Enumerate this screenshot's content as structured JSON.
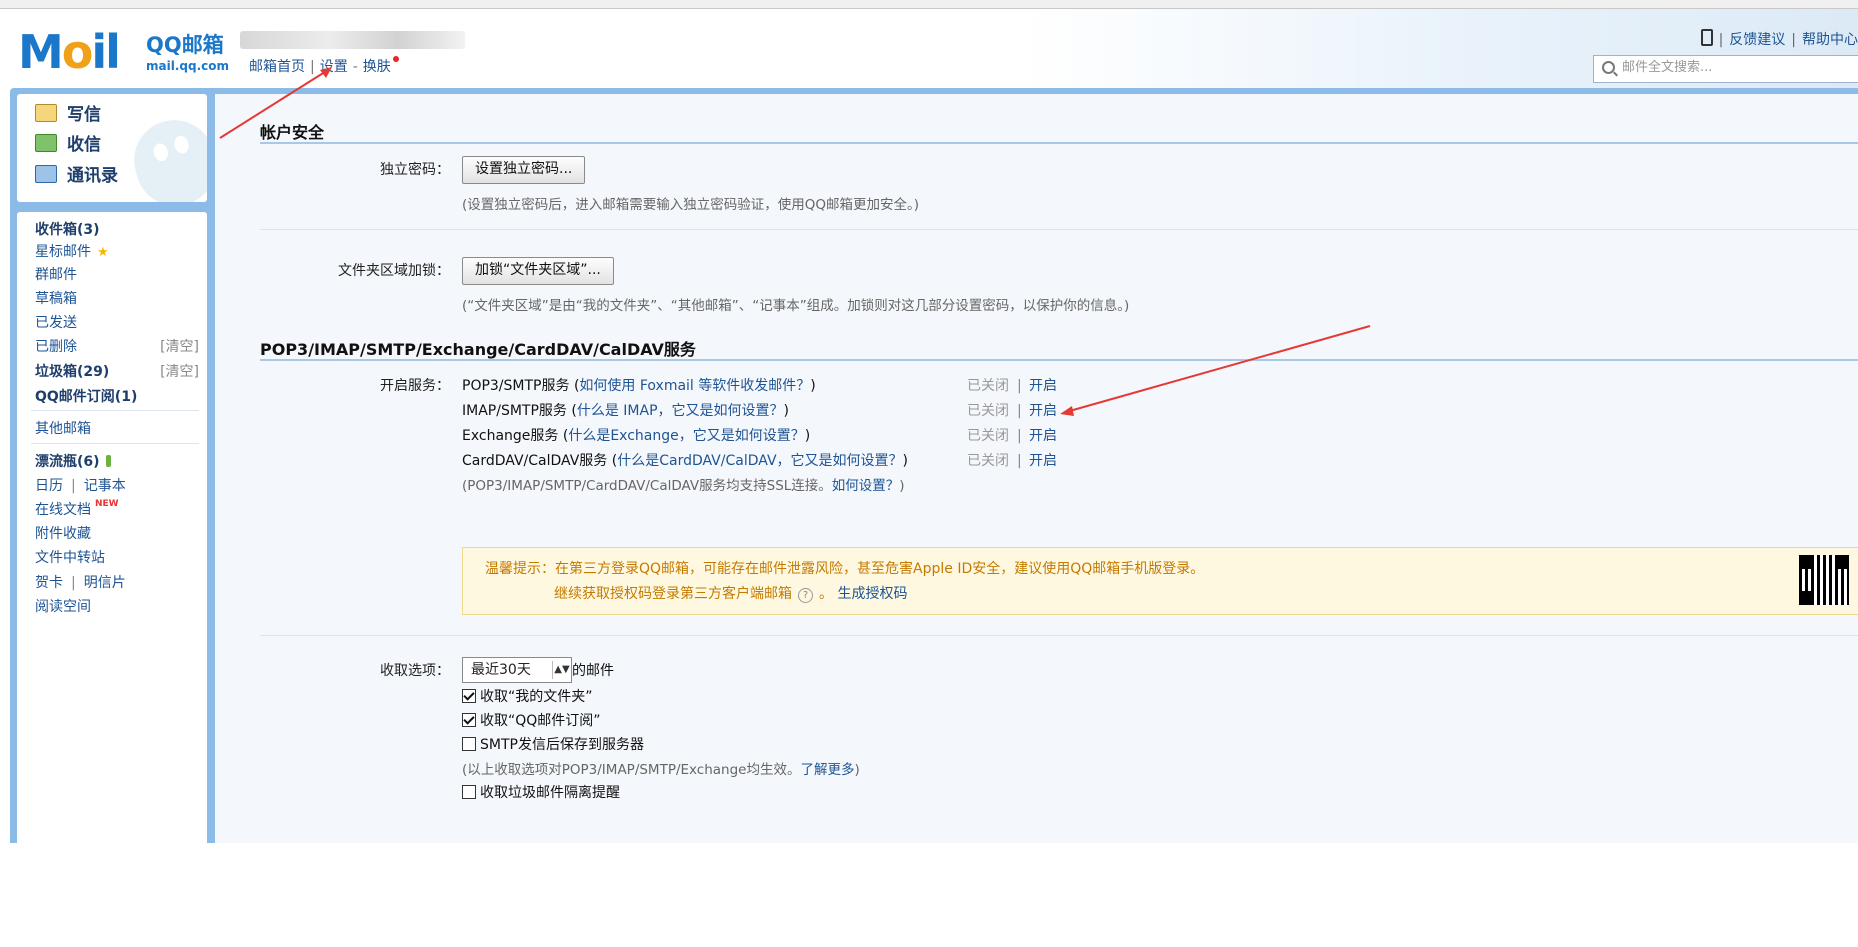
{
  "header": {
    "brand": "QQ邮箱",
    "domain": "mail.qq.com",
    "nav_home": "邮箱首页",
    "nav_settings": "设置",
    "nav_dash": "-",
    "nav_skin": "换肤",
    "feedback": "反馈建议",
    "help": "帮助中心",
    "search_placeholder": "邮件全文搜索..."
  },
  "sidebar": {
    "write": "写信",
    "receive": "收信",
    "contacts": "通讯录",
    "inbox": "收件箱(3)",
    "starred": "星标邮件",
    "group": "群邮件",
    "drafts": "草稿箱",
    "sent": "已发送",
    "deleted": "已删除",
    "clear": "[清空]",
    "spam": "垃圾箱(29)",
    "subscriptions": "QQ邮件订阅(1)",
    "other": "其他邮箱",
    "bottle": "漂流瓶(6)",
    "calendar": "日历",
    "notes": "记事本",
    "docs": "在线文档",
    "new_tag": "NEW",
    "attachments": "附件收藏",
    "transfer": "文件中转站",
    "cards": "贺卡",
    "postcards": "明信片",
    "reading": "阅读空间"
  },
  "security": {
    "title": "帐户安全",
    "pwd_label": "独立密码：",
    "pwd_button": "设置独立密码...",
    "pwd_hint": "(设置独立密码后，进入邮箱需要输入独立密码验证，使用QQ邮箱更加安全。)",
    "folder_label": "文件夹区域加锁：",
    "folder_button": "加锁“文件夹区域”...",
    "folder_hint": "(“文件夹区域”是由“我的文件夹”、“其他邮箱”、“记事本”组成。加锁则对这几部分设置密码，以保护你的信息。)"
  },
  "services": {
    "title": "POP3/IMAP/SMTP/Exchange/CardDAV/CalDAV服务",
    "open_label": "开启服务：",
    "status_closed": "已关闭",
    "open_link": "开启",
    "items": [
      {
        "name": "POP3/SMTP服务 (",
        "help": "如何使用 Foxmail 等软件收发邮件？",
        "close": ")"
      },
      {
        "name": "IMAP/SMTP服务 (",
        "help": "什么是 IMAP，它又是如何设置？",
        "close": ")"
      },
      {
        "name": "Exchange服务 (",
        "help": "什么是Exchange，它又是如何设置？",
        "close": ")"
      },
      {
        "name": "CardDAV/CalDAV服务 (",
        "help": "什么是CardDAV/CalDAV，它又是如何设置？",
        "close": ")"
      }
    ],
    "ssl_hint": "(POP3/IMAP/SMTP/CardDAV/CalDAV服务均支持SSL连接。",
    "ssl_link": "如何设置？",
    "ssl_close": ")",
    "warn_line1": "温馨提示：在第三方登录QQ邮箱，可能存在邮件泄露风险，甚至危害Apple ID安全，建议使用QQ邮箱手机版登录。",
    "warn_line2a": "继续获取授权码登录第三方客户端邮箱",
    "warn_line2b": "。",
    "warn_link": "生成授权码"
  },
  "fetch": {
    "label": "收取选项：",
    "select_value": "最近30天",
    "select_suffix": "的邮件",
    "opt1": "收取“我的文件夹”",
    "opt2": "收取“QQ邮件订阅”",
    "opt3": "SMTP发信后保存到服务器",
    "hint": "(以上收取选项对POP3/IMAP/SMTP/Exchange均生效。",
    "hint_link": "了解更多",
    "hint_close": ")",
    "opt4": "收取垃圾邮件隔离提醒",
    "opt1_checked": true,
    "opt2_checked": true,
    "opt3_checked": false,
    "opt4_checked": false
  },
  "colors": {
    "accent": "#1e5494",
    "frame": "#8bbbe6",
    "annotation_arrow": "#e53935"
  }
}
